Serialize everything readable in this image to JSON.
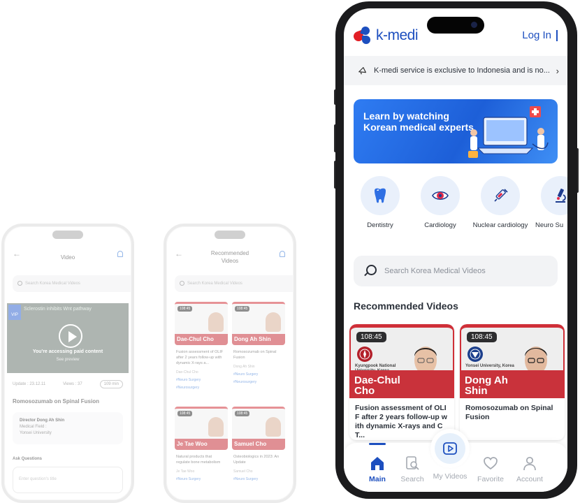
{
  "mini_video": {
    "header_title": "Video",
    "search_placeholder": "Search Korea Medical Videos",
    "vip_label": "VIP",
    "video_caption": "Sclerostin inhibits Wnt pathway",
    "paid_notice": "You're accessing paid content",
    "see_preview": "See preview",
    "update_label": "Update : 23.12.11",
    "views_label": "Views : 37",
    "duration_pill": "109 min",
    "title": "Romosozumab on Spinal Fusion",
    "director": "Director Dong Ah Shin",
    "medical_field": "Medical Field :",
    "university": "Yonsei University",
    "ask_heading": "Ask Questions",
    "ask_placeholder": "Enter question's title"
  },
  "mini_recommended": {
    "header_title": "Recommended Videos",
    "search_placeholder": "Search Korea Medical Videos",
    "cards": [
      {
        "duration": "108:45",
        "name": "Dae-Chul Cho",
        "title": "Fusion assessment of OLIF after 2 years follow-up with dynamic X-rays a...",
        "author": "Dae-Chul Cho",
        "tag1": "#Neuro Surgery",
        "tag2": "#Neurosurgery"
      },
      {
        "duration": "108:45",
        "name": "Dong Ah Shin",
        "title": "Romosozumab on Spinal Fusion",
        "author": "Dong Ah Shin",
        "tag1": "#Neuro Surgery",
        "tag2": "#Neurosurgery"
      },
      {
        "duration": "108:45",
        "name": "Je Tae Woo",
        "title": "Natural products that regulate bone metabolism",
        "author": "Je Tae Woo",
        "tag1": "#Neuro Surgery",
        "tag2": ""
      },
      {
        "duration": "108:45",
        "name": "Samuel Cho",
        "title": "Osteobiologics in 2023: An Update",
        "author": "Samuel Cho",
        "tag1": "#Neuro Surgery",
        "tag2": ""
      }
    ]
  },
  "app": {
    "logo_text": "k-medi",
    "login_label": "Log In",
    "notice_text": "K-medi service is exclusive to Indonesia and is no...",
    "banner_text": "Learn by watching Korean medical experts",
    "categories": [
      {
        "label": "Dentistry",
        "icon": "tooth-icon"
      },
      {
        "label": "Cardiology",
        "icon": "eye-icon"
      },
      {
        "label": "Nuclear cardiology",
        "icon": "syringe-icon"
      },
      {
        "label": "Neuro Su",
        "icon": "microscope-icon"
      }
    ],
    "search_placeholder": "Search Korea Medical Videos",
    "recommended_heading": "Recommended Videos",
    "videos": [
      {
        "duration": "108:45",
        "university": "Kyungpook National University, Korea",
        "name_line1": "Dae-Chul",
        "name_line2": "Cho",
        "title": "Fusion assessment of OLIF after 2 years follow-up with dynamic X-rays and CT..."
      },
      {
        "duration": "108:45",
        "university": "Yonsei University, Korea",
        "name_line1": "Dong Ah",
        "name_line2": "Shin",
        "title": "Romosozumab on Spinal Fusion"
      }
    ],
    "tabs": [
      {
        "label": "Main",
        "icon": "home-icon"
      },
      {
        "label": "Search",
        "icon": "search-doc-icon"
      },
      {
        "label": "My Videos",
        "icon": "play-icon"
      },
      {
        "label": "Favorite",
        "icon": "heart-icon"
      },
      {
        "label": "Account",
        "icon": "person-icon"
      }
    ],
    "accent_color": "#1d4fbf",
    "brand_red": "#e21f26"
  }
}
